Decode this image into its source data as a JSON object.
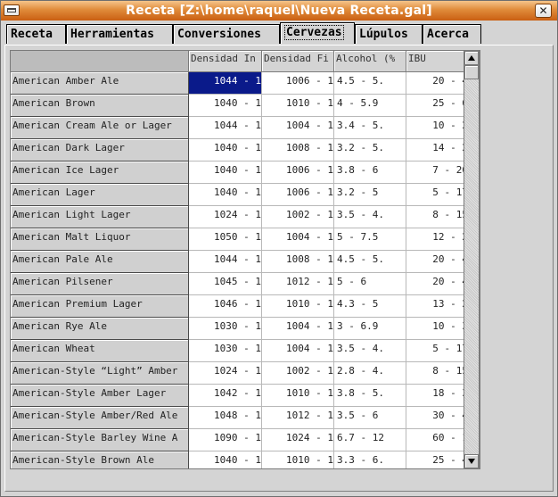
{
  "window": {
    "title": "Receta [Z:\\home\\raquel\\Nueva Receta.gal]",
    "close_glyph": "✕"
  },
  "tabs": [
    {
      "label": "Receta"
    },
    {
      "label": "Herramientas"
    },
    {
      "label": "Conversiones"
    },
    {
      "label": "Cervezas",
      "active": true
    },
    {
      "label": "Lúpulos"
    },
    {
      "label": "Acerca"
    }
  ],
  "table": {
    "columns": [
      "Densidad In",
      "Densidad Fi",
      "Alcohol (%",
      "IBU"
    ],
    "rows": [
      {
        "name": "American Amber Ale",
        "og": "1044 - 1",
        "fg": "1006 - 1",
        "abv": "4.5 - 5.",
        "ibu": "20 - 4"
      },
      {
        "name": "American Brown",
        "og": "1040 - 1",
        "fg": "1010 - 1",
        "abv": "4 - 5.9",
        "ibu": "25 - 6"
      },
      {
        "name": "American Cream Ale or Lager",
        "og": "1044 - 1",
        "fg": "1004 - 1",
        "abv": "3.4 - 5.",
        "ibu": "10 - 2"
      },
      {
        "name": "American Dark Lager",
        "og": "1040 - 1",
        "fg": "1008 - 1",
        "abv": "3.2 - 5.",
        "ibu": "14 - 2"
      },
      {
        "name": "American Ice Lager",
        "og": "1040 - 1",
        "fg": "1006 - 1",
        "abv": "3.8 - 6",
        "ibu": "7 - 20"
      },
      {
        "name": "American Lager",
        "og": "1040 - 1",
        "fg": "1006 - 1",
        "abv": "3.2 - 5",
        "ibu": "5 - 17"
      },
      {
        "name": "American Light Lager",
        "og": "1024 - 1",
        "fg": "1002 - 1",
        "abv": "3.5 - 4.",
        "ibu": "8 - 15"
      },
      {
        "name": "American Malt Liquor",
        "og": "1050 - 1",
        "fg": "1004 - 1",
        "abv": "5 - 7.5",
        "ibu": "12 - 2"
      },
      {
        "name": "American Pale Ale",
        "og": "1044 - 1",
        "fg": "1008 - 1",
        "abv": "4.5 - 5.",
        "ibu": "20 - 4"
      },
      {
        "name": "American Pilsener",
        "og": "1045 - 1",
        "fg": "1012 - 1",
        "abv": "5 - 6",
        "ibu": "20 - 4"
      },
      {
        "name": "American Premium Lager",
        "og": "1046 - 1",
        "fg": "1010 - 1",
        "abv": "4.3 - 5",
        "ibu": "13 - 2"
      },
      {
        "name": "American Rye Ale",
        "og": "1030 - 1",
        "fg": "1004 - 1",
        "abv": "3 - 6.9",
        "ibu": "10 - 3"
      },
      {
        "name": "American Wheat",
        "og": "1030 - 1",
        "fg": "1004 - 1",
        "abv": "3.5 - 4.",
        "ibu": "5 - 17"
      },
      {
        "name": "American-Style “Light” Amber",
        "og": "1024 - 1",
        "fg": "1002 - 1",
        "abv": "2.8 - 4.",
        "ibu": "8 - 15"
      },
      {
        "name": "American-Style Amber Lager",
        "og": "1042 - 1",
        "fg": "1010 - 1",
        "abv": "3.8 - 5.",
        "ibu": "18 - 3"
      },
      {
        "name": "American-Style Amber/Red Ale",
        "og": "1048 - 1",
        "fg": "1012 - 1",
        "abv": "3.5 - 6",
        "ibu": "30 - 4"
      },
      {
        "name": "American-Style Barley Wine A",
        "og": "1090 - 1",
        "fg": "1024 - 1",
        "abv": "6.7 - 12",
        "ibu": "60 - 1"
      },
      {
        "name": "American-Style Brown Ale",
        "og": "1040 - 1",
        "fg": "1010 - 1",
        "abv": "3.3 - 6.",
        "ibu": "25 - 4"
      }
    ],
    "selected": {
      "row": 0,
      "col": "og"
    }
  }
}
